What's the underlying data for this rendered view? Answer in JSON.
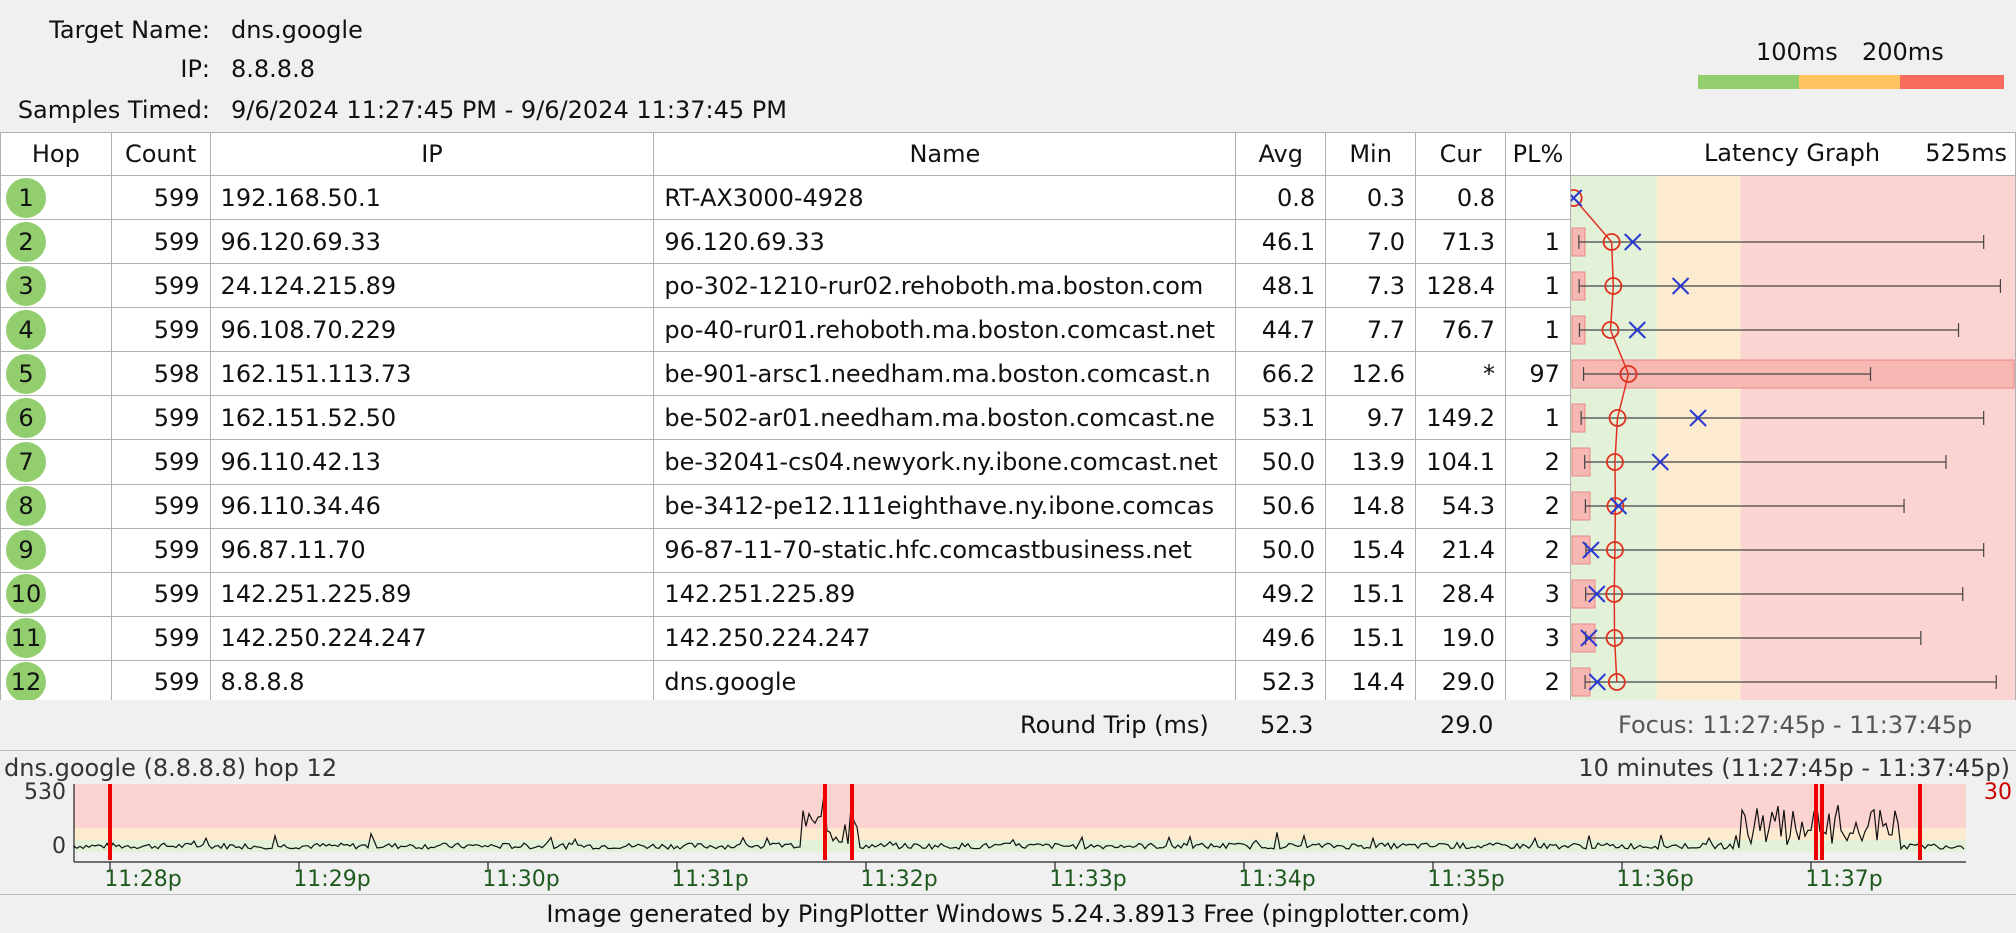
{
  "header": {
    "target_name_label": "Target Name:",
    "target_name": "dns.google",
    "ip_label": "IP:",
    "ip": "8.8.8.8",
    "samples_label": "Samples Timed:",
    "samples": "9/6/2024 11:27:45 PM - 9/6/2024 11:37:45 PM"
  },
  "legend": {
    "label_100": "100ms",
    "label_200": "200ms",
    "colors": [
      "#92cd6e",
      "#fcc35f",
      "#f96b5e"
    ]
  },
  "table": {
    "columns": [
      "Hop",
      "Count",
      "IP",
      "Name",
      "Avg",
      "Min",
      "Cur",
      "PL%",
      "Latency Graph",
      "525ms"
    ],
    "rows": [
      {
        "hop": "1",
        "count": "599",
        "ip": "192.168.50.1",
        "name": "RT-AX3000-4928",
        "avg": "0.8",
        "min": "0.3",
        "cur": "0.8",
        "pl": ""
      },
      {
        "hop": "2",
        "count": "599",
        "ip": "96.120.69.33",
        "name": "96.120.69.33",
        "avg": "46.1",
        "min": "7.0",
        "cur": "71.3",
        "pl": "1"
      },
      {
        "hop": "3",
        "count": "599",
        "ip": "24.124.215.89",
        "name": "po-302-1210-rur02.rehoboth.ma.boston.com",
        "avg": "48.1",
        "min": "7.3",
        "cur": "128.4",
        "pl": "1"
      },
      {
        "hop": "4",
        "count": "599",
        "ip": "96.108.70.229",
        "name": "po-40-rur01.rehoboth.ma.boston.comcast.net",
        "avg": "44.7",
        "min": "7.7",
        "cur": "76.7",
        "pl": "1"
      },
      {
        "hop": "5",
        "count": "598",
        "ip": "162.151.113.73",
        "name": "be-901-arsc1.needham.ma.boston.comcast.n",
        "avg": "66.2",
        "min": "12.6",
        "cur": "*",
        "pl": "97"
      },
      {
        "hop": "6",
        "count": "599",
        "ip": "162.151.52.50",
        "name": "be-502-ar01.needham.ma.boston.comcast.ne",
        "avg": "53.1",
        "min": "9.7",
        "cur": "149.2",
        "pl": "1"
      },
      {
        "hop": "7",
        "count": "599",
        "ip": "96.110.42.13",
        "name": "be-32041-cs04.newyork.ny.ibone.comcast.net",
        "avg": "50.0",
        "min": "13.9",
        "cur": "104.1",
        "pl": "2"
      },
      {
        "hop": "8",
        "count": "599",
        "ip": "96.110.34.46",
        "name": "be-3412-pe12.111eighthave.ny.ibone.comcas",
        "avg": "50.6",
        "min": "14.8",
        "cur": "54.3",
        "pl": "2"
      },
      {
        "hop": "9",
        "count": "599",
        "ip": "96.87.11.70",
        "name": "96-87-11-70-static.hfc.comcastbusiness.net",
        "avg": "50.0",
        "min": "15.4",
        "cur": "21.4",
        "pl": "2"
      },
      {
        "hop": "10",
        "count": "599",
        "ip": "142.251.225.89",
        "name": "142.251.225.89",
        "avg": "49.2",
        "min": "15.1",
        "cur": "28.4",
        "pl": "3"
      },
      {
        "hop": "11",
        "count": "599",
        "ip": "142.250.224.247",
        "name": "142.250.224.247",
        "avg": "49.6",
        "min": "15.1",
        "cur": "19.0",
        "pl": "3"
      },
      {
        "hop": "12",
        "count": "599",
        "ip": "8.8.8.8",
        "name": "dns.google",
        "avg": "52.3",
        "min": "14.4",
        "cur": "29.0",
        "pl": "2"
      }
    ]
  },
  "latency_graph": {
    "scale_max_ms": 525,
    "max_ms": [
      0.8,
      490,
      510,
      460,
      355,
      490,
      445,
      395,
      490,
      465,
      415,
      505
    ]
  },
  "round_trip": {
    "label": "Round Trip (ms)",
    "avg": "52.3",
    "cur": "29.0",
    "focus": "Focus: 11:27:45p - 11:37:45p"
  },
  "timeline": {
    "title": "dns.google (8.8.8.8) hop 12",
    "range": "10 minutes (11:27:45p - 11:37:45p)",
    "y_top": "530",
    "y_bottom": "0",
    "right_value": "30",
    "ticks": [
      "11:28p",
      "11:29p",
      "11:30p",
      "11:31p",
      "11:32p",
      "11:33p",
      "11:34p",
      "11:35p",
      "11:36p",
      "11:37p"
    ]
  },
  "footer": {
    "text": "Image generated by PingPlotter Windows 5.24.3.8913 Free (pingplotter.com)"
  }
}
